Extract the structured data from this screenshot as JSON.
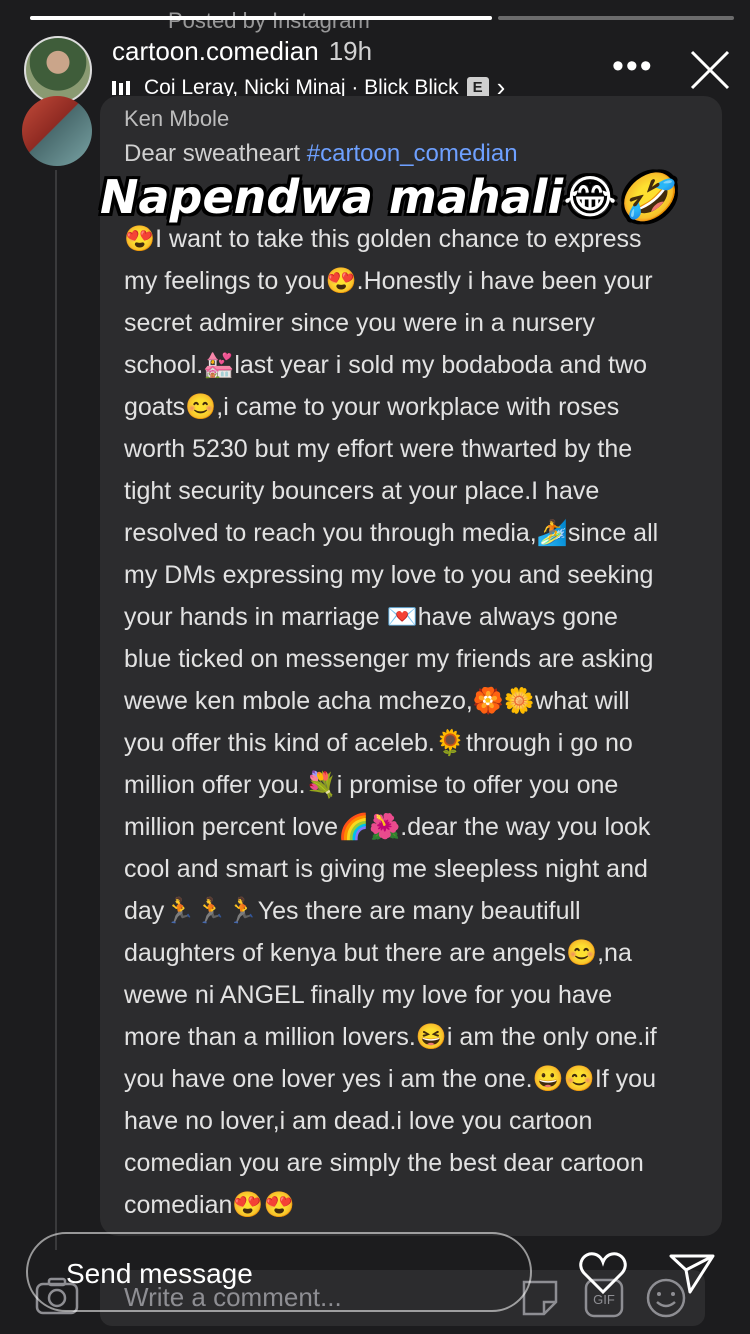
{
  "story": {
    "posted_by": "Posted by Instagram",
    "username": "cartoon.comedian",
    "time": "19h",
    "music": "Coi Leray, Nicki Minaj · Blick Blick",
    "explicit_badge": "E",
    "music_chevron": "›",
    "more": "•••",
    "progress": [
      1.0,
      0.0
    ]
  },
  "comment": {
    "author": "Ken Mbole",
    "greeting_text": "Dear sweatheart ",
    "hashtag": "#cartoon_comedian",
    "lines": [
      "😍I want to take this golden chance to express",
      "my feelings to you😍.Honestly i have been your",
      "secret admirer since you were in a nursery",
      "school.💒last year i sold my bodaboda and two",
      "goats😊,i came to your workplace with roses",
      "worth 5230 but my effort were thwarted by the",
      "tight security bouncers at your place.I have",
      "resolved to reach you through media,🏄since all",
      "my DMs expressing my love to you and seeking",
      "your hands in marriage 💌have always gone",
      "blue ticked on messenger my friends  are asking",
      "wewe ken mbole acha mchezo,🏵️🌼what will",
      "you offer this kind of aceleb.🌻through i go no",
      "million offer you.💐i promise to offer you one",
      "million percent love🌈🌺.dear the way you look",
      "cool and smart is giving me sleepless night and",
      "day🏃🏃🏃Yes there are many beautifull",
      "daughters of kenya but there are angels😊,na",
      "wewe ni ANGEL finally my love for you have",
      "more than a million lovers.😆i am the only one.if",
      "you have one lover yes i am the one.😀😊If you",
      "have no lover,i am dead.i love you cartoon",
      "comedian  you are simply the best dear cartoon",
      "comedian😍😍"
    ]
  },
  "overlay_text": "Napendwa mahali😂🤣",
  "bottom": {
    "send_placeholder": "Send message",
    "comment_placeholder": "Write a comment..."
  },
  "colors": {
    "background": "#1c1c1e",
    "card": "#2c2c2e",
    "hashtag": "#6ea0ff"
  }
}
